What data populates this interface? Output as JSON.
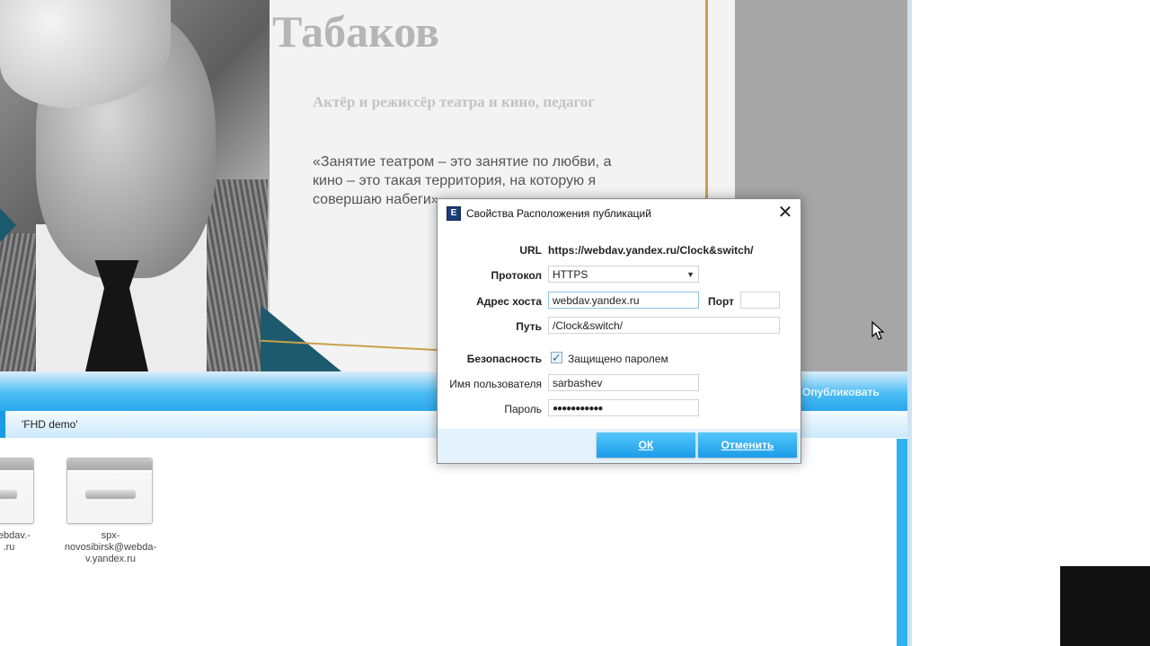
{
  "slide": {
    "name": "Табаков",
    "subtitle": "Актёр и режиссёр театра и кино, педагог",
    "quote": "«Занятие театром – это занятие по любви, а кино – это такая территория, на которую я совершаю набеги»"
  },
  "app": {
    "publish_button": "Опубликовать",
    "tab_label": "'FHD demo'",
    "locations": [
      {
        "label": "webdav.-\n.ru"
      },
      {
        "label": "spx-\nnovosibirsk@webda-\nv.yandex.ru"
      }
    ]
  },
  "dialog": {
    "title": "Свойства Расположения публикаций",
    "close_glyph": "✕",
    "url_label": "URL",
    "url_value": "https://webdav.yandex.ru/Clock&switch/",
    "protocol_label": "Протокол",
    "protocol_value": "HTTPS",
    "host_label": "Адрес хоста",
    "host_value": "webdav.yandex.ru",
    "port_label": "Порт",
    "port_value": "",
    "path_label": "Путь",
    "path_value": "/Clock&switch/",
    "security_label": "Безопасность",
    "password_protected_label": "Защищено паролем",
    "password_protected_checked": true,
    "username_label": "Имя пользователя",
    "username_value": "sarbashev",
    "password_label": "Пароль",
    "password_value": "●●●●●●●●●●●",
    "ok_label": "ОК",
    "cancel_label": "Отменить"
  },
  "icons": {
    "dialog_app_icon": "app-icon",
    "close": "close-icon",
    "dropdown": "chevron-down-icon",
    "checkbox": "checkmark-icon",
    "cursor": "mouse-pointer-icon"
  }
}
